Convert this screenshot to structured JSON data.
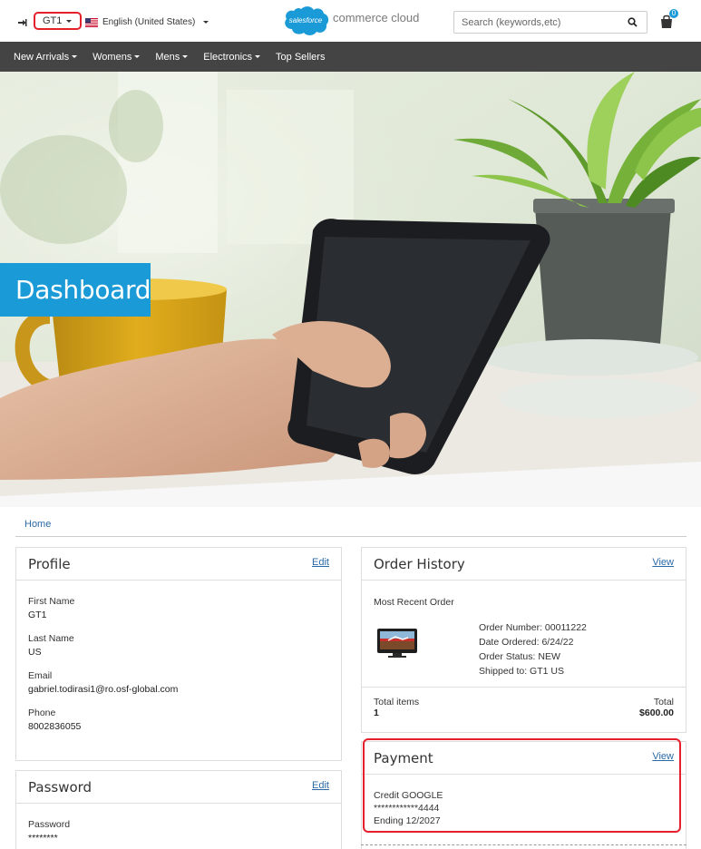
{
  "header": {
    "user_label": "GT1",
    "language": "English (United States)",
    "logo_cloud_text": "salesforce",
    "logo_text": "commerce cloud",
    "search_placeholder": "Search (keywords,etc)",
    "cart_count": "0"
  },
  "nav": {
    "items": [
      {
        "label": "New Arrivals",
        "has_menu": true
      },
      {
        "label": "Womens",
        "has_menu": true
      },
      {
        "label": "Mens",
        "has_menu": true
      },
      {
        "label": "Electronics",
        "has_menu": true
      },
      {
        "label": "Top Sellers",
        "has_menu": false
      }
    ]
  },
  "hero": {
    "title": "Dashboard"
  },
  "breadcrumb": {
    "home": "Home"
  },
  "profile": {
    "title": "Profile",
    "edit_label": "Edit",
    "fields": [
      {
        "label": "First Name",
        "value": "GT1"
      },
      {
        "label": "Last Name",
        "value": "US"
      },
      {
        "label": "Email",
        "value": "gabriel.todirasi1@ro.osf-global.com"
      },
      {
        "label": "Phone",
        "value": "8002836055"
      }
    ]
  },
  "password": {
    "title": "Password",
    "edit_label": "Edit",
    "label": "Password",
    "value": "********"
  },
  "order_history": {
    "title": "Order History",
    "view_label": "View",
    "recent_label": "Most Recent Order",
    "order_number": "Order Number: 00011222",
    "date_ordered": "Date Ordered: 6/24/22",
    "order_status": "Order Status: NEW",
    "shipped_to": "Shipped to: GT1 US",
    "total_items_label": "Total items",
    "total_items_value": "1",
    "total_label": "Total",
    "total_value": "$600.00"
  },
  "payment": {
    "title": "Payment",
    "view_label": "View",
    "card_type": "Credit GOOGLE",
    "card_number": "************4444",
    "expiry": "Ending 12/2027"
  },
  "colors": {
    "accent": "#1a9ad6",
    "nav_bg": "#444444",
    "highlight": "#e5202b",
    "link": "#2b6aa6"
  }
}
